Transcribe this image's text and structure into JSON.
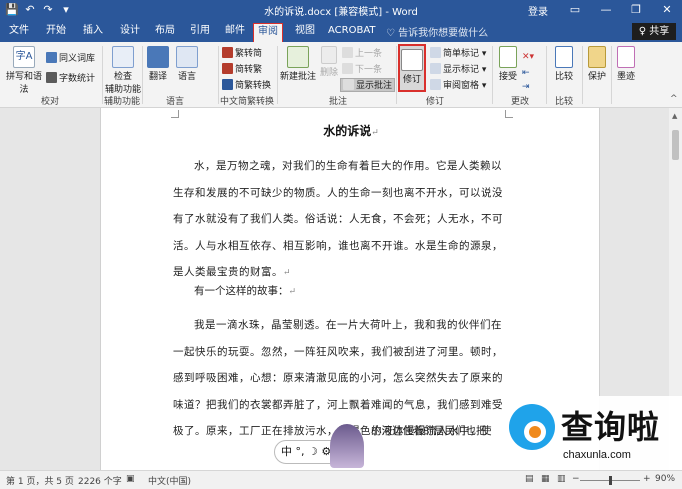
{
  "app": {
    "title": "水的诉说.docx [兼容模式] - Word",
    "login": "登录",
    "share": "共享",
    "tell_me": "告诉我你想要做什么",
    "window_controls": [
      "▭",
      "—",
      "❐",
      "✕"
    ],
    "quick_access": [
      "💾",
      "↶",
      "↷",
      "▾"
    ]
  },
  "tabs": [
    {
      "label": "文件",
      "active": false
    },
    {
      "label": "开始",
      "active": false
    },
    {
      "label": "插入",
      "active": false
    },
    {
      "label": "设计",
      "active": false
    },
    {
      "label": "布局",
      "active": false
    },
    {
      "label": "引用",
      "active": false
    },
    {
      "label": "邮件",
      "active": false
    },
    {
      "label": "审阅",
      "active": true
    },
    {
      "label": "视图",
      "active": false
    },
    {
      "label": "ACROBAT",
      "active": false
    }
  ],
  "ribbon": {
    "proofing": {
      "spell": "拼写和语法",
      "thesaurus": "同义词库",
      "wordcount": "字数统计",
      "label": "校对"
    },
    "accessibility": {
      "check": "检查",
      "check2": "辅助功能",
      "label": "辅助功能"
    },
    "language": {
      "translate": "翻译",
      "language": "语言",
      "label": "语言"
    },
    "chinese_conv": {
      "to_trad": "繁转简",
      "to_simp": "简转繁",
      "convert": "简繁转换",
      "label": "中文简繁转换"
    },
    "comments": {
      "new": "新建批注",
      "delete": "删除",
      "prev": "上一条",
      "next": "下一条",
      "show": "显示批注",
      "label": "批注"
    },
    "tracking": {
      "track": "修订",
      "simple_markup": "简单标记",
      "show_markup": "显示标记",
      "review_pane": "审阅窗格",
      "label": "修订"
    },
    "changes": {
      "accept": "接受",
      "label": "更改"
    },
    "compare": {
      "compare": "比较",
      "label": "比较"
    },
    "protect": {
      "protect": "保护",
      "ink": "墨迹"
    }
  },
  "document": {
    "title": "水的诉说",
    "paragraphs": [
      "水，是万物之魂，对我们的生命有着巨大的作用。它是人类赖以生存和发展的不可缺少的物质。人的生命一刻也离不开水，可以说没有了水就没有了我们人类。俗话说：人无食，不会死；人无水，不可活。人与水相互依存、相互影响，谁也离不开谁。水是生命的源泉，是人类最宝贵的财富。",
      "有一个这样的故事：",
      "我是一滴水珠，晶莹剔透。在一片大荷叶上，我和我的伙伴们在一起快乐的玩耍。忽然，一阵狂风吹来，我们被刮进了河里。顿时，感到呼吸困难，心想：原来清澈见底的小河，怎么突然失去了原来的味道？把我们的衣裳都弄脏了，河上飘着难闻的气息，我们感到难受极了。原来，工厂正在排放污水，黄褐色的液体慢慢流入水中，使",
      "小河边住着的居民们也把"
    ],
    "para_mark": "↵"
  },
  "ime": {
    "text": "中 °, ☽ ⚙"
  },
  "watermark": {
    "brand": "查询啦",
    "url": "chaxunla.com"
  },
  "status": {
    "page": "第 1 页，共 5 页",
    "words": "2226 个字",
    "language": "中文(中国)",
    "zoom": "90%",
    "zoom_value": 90
  }
}
